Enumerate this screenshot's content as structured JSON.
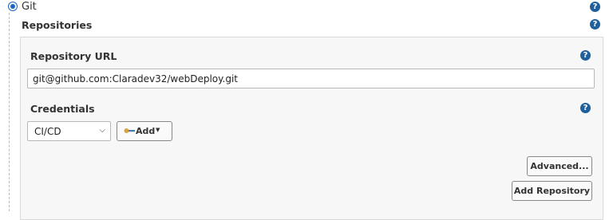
{
  "scm": {
    "option_label": "Git",
    "selected": true
  },
  "repositories": {
    "section_title": "Repositories",
    "repository_url": {
      "label": "Repository URL",
      "value": "git@github.com:Claradev32/webDeploy.git"
    },
    "credentials": {
      "label": "Credentials",
      "selected": "CI/CD",
      "add_button_label": "Add"
    },
    "advanced_button_label": "Advanced...",
    "add_repository_button_label": "Add Repository"
  },
  "help_icon_glyph": "?",
  "colors": {
    "help_icon": "#1f5f9b",
    "radio_selected": "#1a66c9",
    "panel_background": "#f7f7f7",
    "key_icon": "#d6a24a"
  }
}
